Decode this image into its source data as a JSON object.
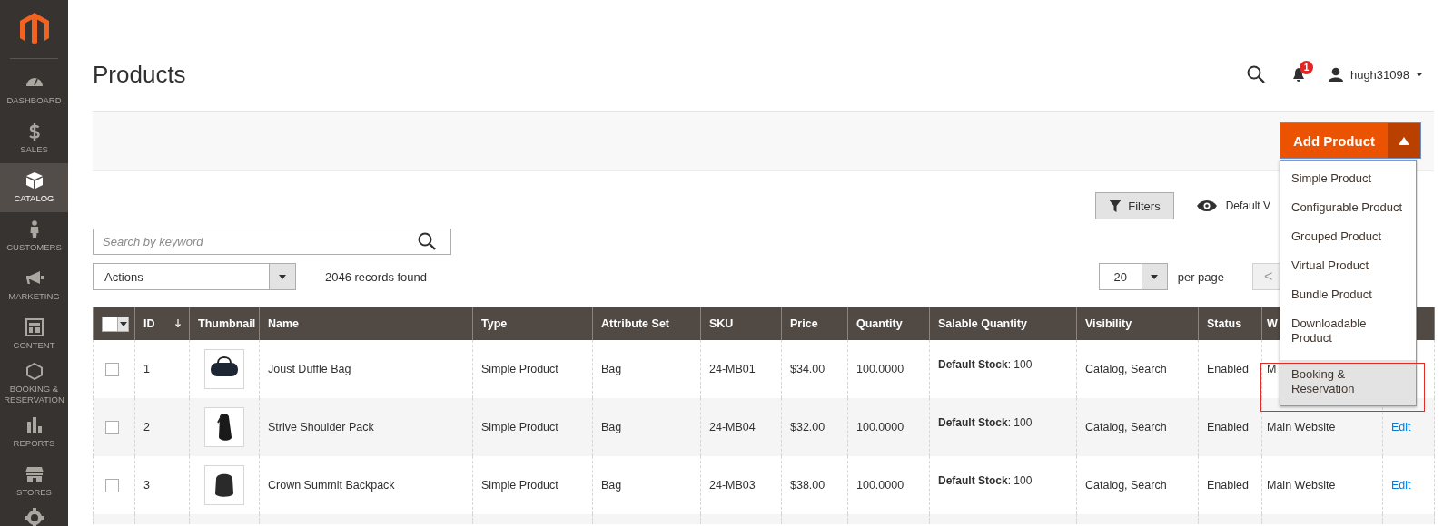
{
  "sidebar": {
    "items": [
      {
        "label": "DASHBOARD",
        "selected": false
      },
      {
        "label": "SALES",
        "selected": false
      },
      {
        "label": "CATALOG",
        "selected": true
      },
      {
        "label": "CUSTOMERS",
        "selected": false
      },
      {
        "label": "MARKETING",
        "selected": false
      },
      {
        "label": "CONTENT",
        "selected": false
      },
      {
        "label": "BOOKING & RESERVATION",
        "selected": false
      },
      {
        "label": "REPORTS",
        "selected": false
      },
      {
        "label": "STORES",
        "selected": false
      }
    ]
  },
  "header": {
    "title": "Products",
    "notification_count": "1",
    "user": "hugh31098"
  },
  "page_actions": {
    "add_button": "Add Product",
    "menu_expanded": true,
    "menu": [
      {
        "label": "Simple Product",
        "selected": false
      },
      {
        "label": "Configurable Product",
        "selected": false
      },
      {
        "label": "Grouped Product",
        "selected": false
      },
      {
        "label": "Virtual Product",
        "selected": false
      },
      {
        "label": "Bundle Product",
        "selected": false
      },
      {
        "label": "Downloadable Product",
        "selected": false
      },
      {
        "label": "Booking & Reservation",
        "selected": true
      }
    ]
  },
  "toolbar": {
    "filters_button": "Filters",
    "view_label": "Default V",
    "search": {
      "placeholder": "Search by keyword"
    },
    "actions": "Actions",
    "records": "2046 records found",
    "per_page_value": "20",
    "per_page_label": "per page",
    "prev_button": "<"
  },
  "table": {
    "select_all_checked": false,
    "columns": [
      "ID",
      "Thumbnail",
      "Name",
      "Type",
      "Attribute Set",
      "SKU",
      "Price",
      "Quantity",
      "Salable Quantity",
      "Visibility",
      "Status",
      "W"
    ],
    "rows": [
      {
        "checked": false,
        "id": "1",
        "name": "Joust Duffle Bag",
        "type": "Simple Product",
        "attribute_set": "Bag",
        "sku": "24-MB01",
        "price": "$34.00",
        "quantity": "100.0000",
        "salable": "**Default Stock**: 100",
        "visibility": "Catalog, Search",
        "status": "Enabled",
        "website": "M"
      },
      {
        "checked": false,
        "id": "2",
        "name": "Strive Shoulder Pack",
        "type": "Simple Product",
        "attribute_set": "Bag",
        "sku": "24-MB04",
        "price": "$32.00",
        "quantity": "100.0000",
        "salable": "**Default Stock**: 100",
        "visibility": "Catalog, Search",
        "status": "Enabled",
        "website": "Main Website",
        "action": "Edit"
      },
      {
        "checked": false,
        "id": "3",
        "name": "Crown Summit Backpack",
        "type": "Simple Product",
        "attribute_set": "Bag",
        "sku": "24-MB03",
        "price": "$38.00",
        "quantity": "100.0000",
        "salable": "**Default Stock**: 100",
        "visibility": "Catalog, Search",
        "status": "Enabled",
        "website": "Main Website",
        "action": "Edit"
      }
    ]
  }
}
